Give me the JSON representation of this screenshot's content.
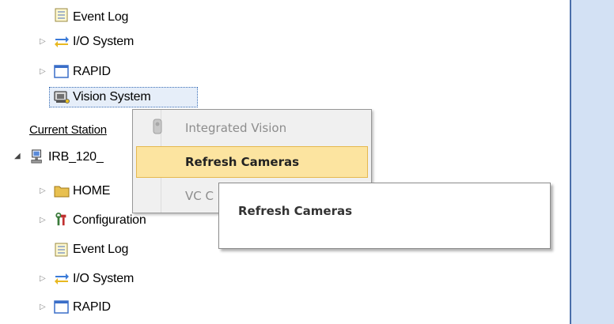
{
  "tree": {
    "station_items": [
      {
        "label": "Event Log",
        "icon": "event-log-icon"
      },
      {
        "label": "I/O System",
        "icon": "io-system-icon"
      },
      {
        "label": "RAPID",
        "icon": "rapid-icon"
      },
      {
        "label": "Vision System",
        "icon": "vision-system-icon"
      }
    ],
    "current_station_label": "Current Station",
    "controller_label": "IRB_120_",
    "controller_items": [
      {
        "label": "HOME",
        "icon": "folder-icon"
      },
      {
        "label": "Configuration",
        "icon": "configuration-icon"
      },
      {
        "label": "Event Log",
        "icon": "event-log-icon"
      },
      {
        "label": "I/O System",
        "icon": "io-system-icon"
      },
      {
        "label": "RAPID",
        "icon": "rapid-icon"
      }
    ]
  },
  "context_menu": {
    "items": [
      {
        "label": "Integrated Vision",
        "enabled": false
      },
      {
        "label": "Refresh Cameras",
        "enabled": true,
        "highlighted": true
      },
      {
        "label": "VC C",
        "enabled": false
      }
    ]
  },
  "tooltip": {
    "text": "Refresh Cameras"
  },
  "colors": {
    "selection_fill": "#e6eef9",
    "menu_highlight": "#fce4a0",
    "right_panel": "#d3e1f4"
  }
}
